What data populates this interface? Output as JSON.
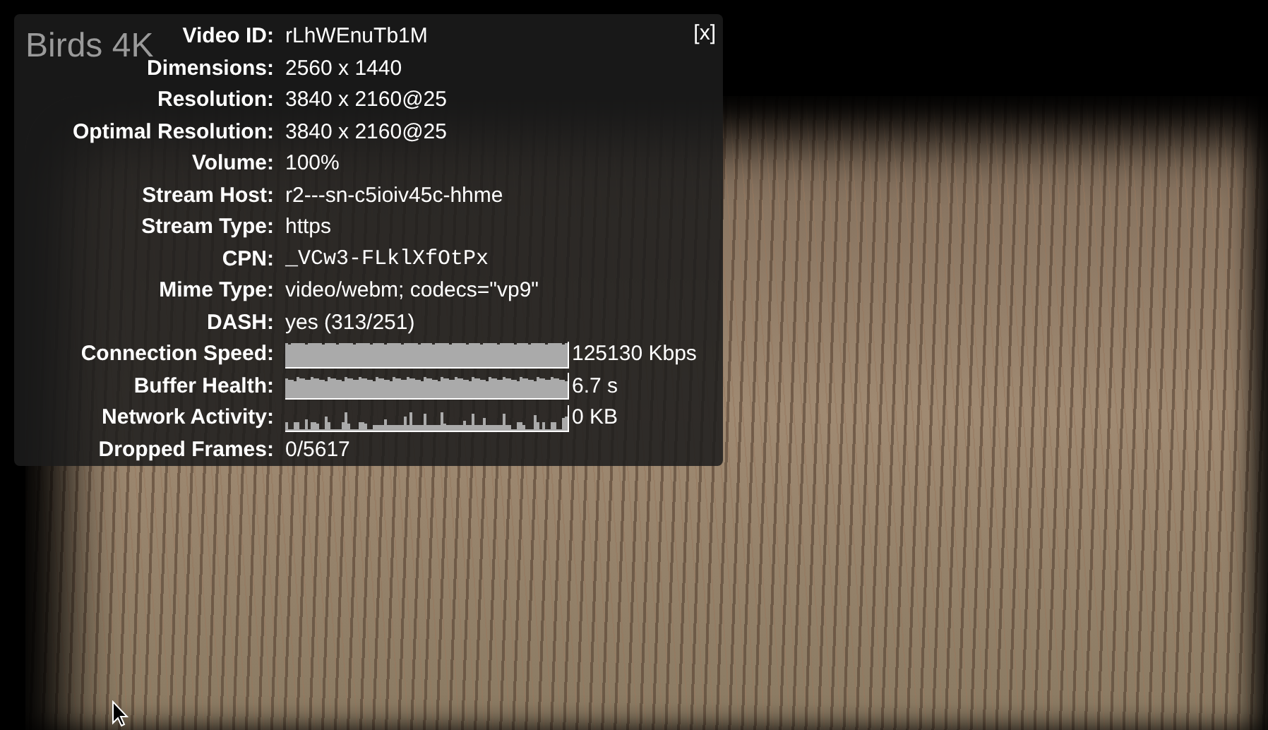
{
  "video": {
    "title": "Birds 4K"
  },
  "stats_panel": {
    "close": "[x]",
    "rows": [
      {
        "label": "Video ID:",
        "kind": "text",
        "value": "rLhWEnuTb1M"
      },
      {
        "label": "Dimensions:",
        "kind": "text",
        "value": "2560 x 1440"
      },
      {
        "label": "Resolution:",
        "kind": "text",
        "value": "3840 x 2160@25"
      },
      {
        "label": "Optimal Resolution:",
        "kind": "text",
        "value": "3840 x 2160@25"
      },
      {
        "label": "Volume:",
        "kind": "text",
        "value": "100%"
      },
      {
        "label": "Stream Host:",
        "kind": "text",
        "value": "r2---sn-c5ioiv45c-hhme"
      },
      {
        "label": "Stream Type:",
        "kind": "text",
        "value": "https"
      },
      {
        "label": "CPN:",
        "kind": "mono",
        "value": "_VCw3-FLklXfOtPx"
      },
      {
        "label": "Mime Type:",
        "kind": "text",
        "value": "video/webm; codecs=\"vp9\""
      },
      {
        "label": "DASH:",
        "kind": "text",
        "value": "yes (313/251)"
      },
      {
        "label": "Connection Speed:",
        "kind": "graph",
        "value": "125130 Kbps"
      },
      {
        "label": "Buffer Health:",
        "kind": "graph",
        "value": "6.7 s"
      },
      {
        "label": "Network Activity:",
        "kind": "graph",
        "value": "0 KB"
      },
      {
        "label": "Dropped Frames:",
        "kind": "text",
        "value": "0/5617"
      }
    ]
  }
}
